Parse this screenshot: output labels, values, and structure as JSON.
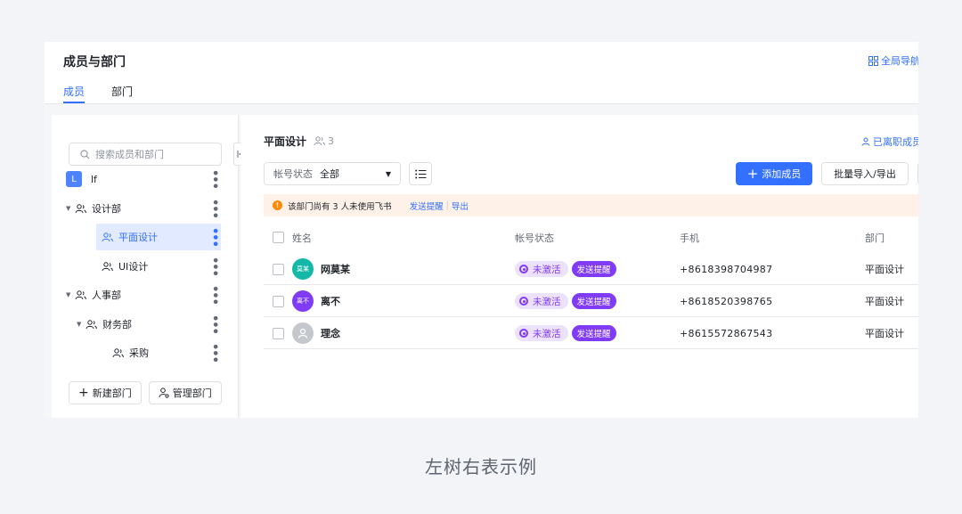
{
  "header": {
    "title": "成员与部门",
    "global_nav": "全局导航",
    "tabs": [
      {
        "label": "成员",
        "active": true
      },
      {
        "label": "部门",
        "active": false
      }
    ]
  },
  "sidebar": {
    "search_placeholder": "搜索成员和部门",
    "tree": [
      {
        "label": "lf",
        "badge": "L",
        "type": "root"
      },
      {
        "label": "设计部",
        "type": "dept",
        "expanded": true
      },
      {
        "label": "平面设计",
        "type": "dept",
        "selected": true
      },
      {
        "label": "UI设计",
        "type": "dept"
      },
      {
        "label": "人事部",
        "type": "dept",
        "expanded": true
      },
      {
        "label": "财务部",
        "type": "dept",
        "expanded": true
      },
      {
        "label": "采购",
        "type": "dept"
      }
    ],
    "new_dept_label": "新建部门",
    "manage_dept_label": "管理部门"
  },
  "main": {
    "dept_title": "平面设计",
    "member_count": "3",
    "resigned_label": "已离职成员",
    "status_filter_label": "帐号状态",
    "status_filter_value": "全部",
    "add_member_label": "添加成员",
    "import_export_label": "批量导入/导出",
    "notice": {
      "text": "该部门尚有 3 人未使用飞书",
      "send_link": "发送提醒",
      "export_link": "导出"
    },
    "columns": [
      "姓名",
      "帐号状态",
      "手机",
      "部门"
    ],
    "rows": [
      {
        "avatar_text": "莫某",
        "avatar_color": "#14b8a6",
        "name": "网莫某",
        "status": "未激活",
        "remind": "发送提醒",
        "phone": "+8618398704987",
        "dept": "平面设计"
      },
      {
        "avatar_text": "离不",
        "avatar_color": "#7f3bf5",
        "name": "离不",
        "status": "未激活",
        "remind": "发送提醒",
        "phone": "+8618520398765",
        "dept": "平面设计"
      },
      {
        "avatar_text": "",
        "avatar_color": "#c4c7cc",
        "name": "理念",
        "status": "未激活",
        "remind": "发送提醒",
        "phone": "+8615572867543",
        "dept": "平面设计"
      }
    ]
  },
  "caption": "左树右表示例",
  "colors": {
    "accent": "#3370ff",
    "status_purple": "#7f3bf5",
    "warning": "#ff8800"
  }
}
